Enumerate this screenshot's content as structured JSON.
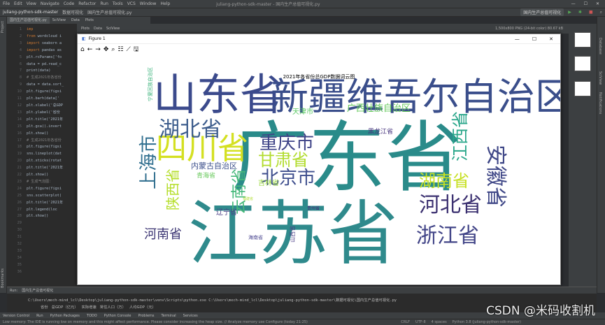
{
  "menubar": {
    "items": [
      "File",
      "Edit",
      "View",
      "Navigate",
      "Code",
      "Refactor",
      "Run",
      "Tools",
      "VCS",
      "Window",
      "Help"
    ],
    "window_title": "juliang-python-sdk-master - 国内生产总值可视化.py"
  },
  "navbar": {
    "project": "juliang-python-sdk-master",
    "folder": "数据可视化",
    "file": "国内生产总值可视化.py",
    "run_config": "国内生产总值可视化"
  },
  "editor": {
    "tabs": [
      "国内生产总值可视化.py",
      "SciView",
      "Data",
      "Plots"
    ],
    "zoom": "15",
    "lines": [
      [
        "kw",
        "imp"
      ],
      [
        "kw",
        "from",
        " wordcloud i"
      ],
      [
        "kw",
        "import",
        " seaborn a"
      ],
      [
        "kw",
        "import",
        " pandas as"
      ],
      [
        "tx",
        ""
      ],
      [
        "tx",
        "plt.rcParams['fo"
      ],
      [
        "tx",
        ""
      ],
      [
        "tx",
        "data = pd.read_c"
      ],
      [
        "tx",
        "print(data)"
      ],
      [
        "tx",
        ""
      ],
      [
        "cm",
        "# 生成2021年各省份"
      ],
      [
        "tx",
        "data = data.sort_"
      ],
      [
        "tx",
        "plt.figure(figsi"
      ],
      [
        "tx",
        "plt.barh(data['"
      ],
      [
        "tx",
        "plt.xlabel('总GDP"
      ],
      [
        "tx",
        "plt.ylabel('省份"
      ],
      [
        "tx",
        "plt.title('2021年"
      ],
      [
        "tx",
        "plt.gca().invert"
      ],
      [
        "tx",
        "plt.show()"
      ],
      [
        "tx",
        ""
      ],
      [
        "cm",
        "# 生成2021年各省份"
      ],
      [
        "tx",
        "plt.figure(figsi"
      ],
      [
        "tx",
        "sns.lineplot(dat"
      ],
      [
        "tx",
        "plt.xticks(rotat"
      ],
      [
        "tx",
        "plt.title('2021年"
      ],
      [
        "tx",
        "plt.show()"
      ],
      [
        "tx",
        ""
      ],
      [
        "tx",
        ""
      ],
      [
        "tx",
        ""
      ],
      [
        "tx",
        ""
      ],
      [
        "cm",
        "# 生成气泡图："
      ],
      [
        "tx",
        "plt.figure(figsi"
      ],
      [
        "tx",
        "sns.scatterplot("
      ],
      [
        "tx",
        "plt.title('2021年"
      ],
      [
        "tx",
        "plt.legend(loc"
      ],
      [
        "tx",
        "plt.show()"
      ]
    ]
  },
  "sciview": {
    "toolbar": [
      "SciView",
      "Data",
      "Plots"
    ],
    "image_info": "1,500x800 PNG (24-bit color) 80.67 kB"
  },
  "figure": {
    "title": "Figure 1",
    "controls": [
      "—",
      "☐",
      "✕"
    ]
  },
  "chart_data": {
    "type": "wordcloud",
    "title": "2021年各省份总GDP数据词云图",
    "words": [
      {
        "text": "广东省",
        "color": "#2a8b8a"
      },
      {
        "text": "江苏省",
        "color": "#2f8a8c"
      },
      {
        "text": "山东省",
        "color": "#3b4a8c"
      },
      {
        "text": "新疆维吾尔自治区",
        "color": "#3a4e8b"
      },
      {
        "text": "四川省",
        "color": "#d4e022"
      },
      {
        "text": "湖北省",
        "color": "#3c5c8c"
      },
      {
        "text": "重庆市",
        "color": "#3e4387"
      },
      {
        "text": "甘肃省",
        "color": "#b2dc2e"
      },
      {
        "text": "北京市",
        "color": "#3e4e8d"
      },
      {
        "text": "安徽省",
        "color": "#3f4787"
      },
      {
        "text": "江西省",
        "color": "#29a68a"
      },
      {
        "text": "湖南省",
        "color": "#c7e023"
      },
      {
        "text": "河北省",
        "color": "#3b3070"
      },
      {
        "text": "浙江省",
        "color": "#414487"
      },
      {
        "text": "上海市",
        "color": "#2f6e8e"
      },
      {
        "text": "陕西省",
        "color": "#b5de2b"
      },
      {
        "text": "云南省",
        "color": "#46b87a"
      },
      {
        "text": "河南省",
        "color": "#3a3372"
      },
      {
        "text": "广西壮族自治区",
        "color": "#63c85a"
      },
      {
        "text": "天津市",
        "color": "#5ac864"
      },
      {
        "text": "黑龙江省",
        "color": "#45337d"
      },
      {
        "text": "内蒙古自治区",
        "color": "#3c508b"
      },
      {
        "text": "青海省",
        "color": "#69c95c"
      },
      {
        "text": "吉林省",
        "color": "#9bd93c"
      },
      {
        "text": "辽宁省",
        "color": "#4a3d85"
      },
      {
        "text": "山西省",
        "color": "#4c3f87"
      },
      {
        "text": "宁夏回族自治区",
        "color": "#3fb47e"
      },
      {
        "text": "海南省",
        "color": "#4a4690"
      },
      {
        "text": "贵州省",
        "color": "#482677"
      },
      {
        "text": "福建省",
        "color": "#b0dd2f"
      }
    ]
  },
  "run": {
    "tab": "国内生产总值可视化",
    "cmd": "C:\\Users\\mech-mind_lcl\\Desktop\\juliang-python-sdk-master\\venv\\Scripts\\python.exe C:\\Users\\mech-mind_lcl\\Desktop\\juliang-python-sdk-master\\数据可视化\\国内生产总值可视化.py",
    "header": "省份   总GDP（亿元）   实际增速   常住人口（万）   人均GDP（元）"
  },
  "bottom_tabs": [
    "Version Control",
    "Run",
    "Python Packages",
    "TODO",
    "Python Console",
    "Problems",
    "Terminal",
    "Services"
  ],
  "status": {
    "message": "Low memory: The IDE is running low on memory and this might affect performance. Please consider increasing the heap size. // Analyze memory use  Configure (today 21:25)",
    "crlf": "CRLF",
    "enc": "UTF-8",
    "indent": "4 spaces",
    "interp": "Python 3.8 (juliang-python-sdk-master)"
  },
  "watermark": "CSDN @米码收割机"
}
